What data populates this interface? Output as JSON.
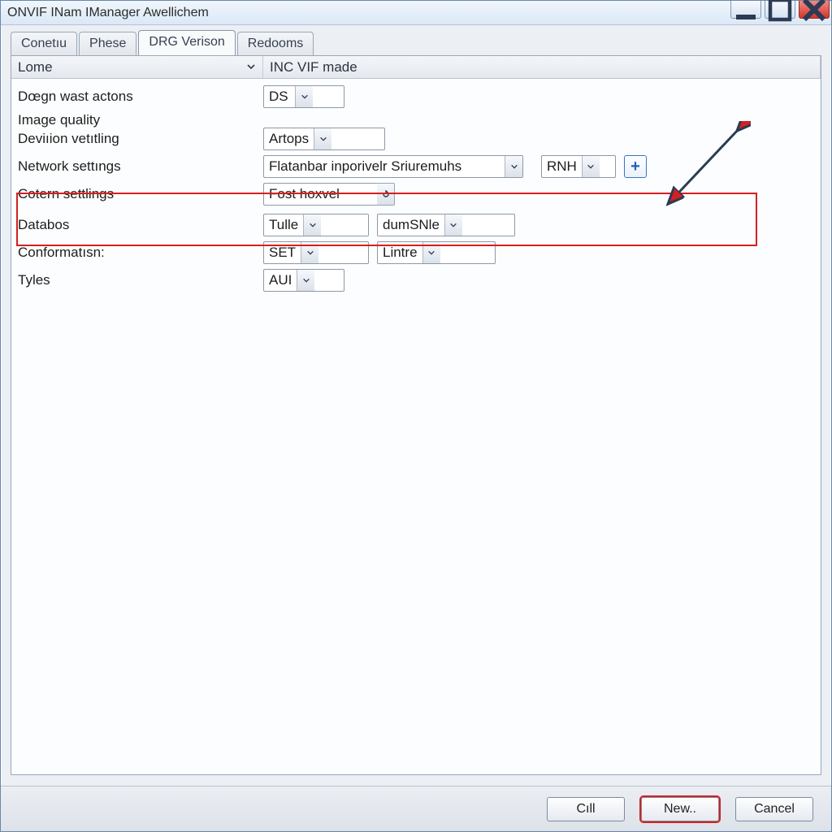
{
  "window": {
    "title": "ONVIF INam IManager Awellichem"
  },
  "tabs": {
    "items": [
      {
        "label": "Conetıu"
      },
      {
        "label": "Phese"
      },
      {
        "label": "DRG Verison"
      },
      {
        "label": "Redooms"
      }
    ],
    "active_index": 2
  },
  "grid_header": {
    "label_col": "Lome",
    "value_col": "INC VIF made"
  },
  "fields": {
    "design_actions": {
      "label": "Dœgn wast actons",
      "value": "DS"
    },
    "image_quality": {
      "label": "Image quality"
    },
    "deviation": {
      "label": "Deviıion vetıtling",
      "value": "Artops"
    },
    "network": {
      "label": "Network settıngs",
      "value": "Flatanbar inporivelr Sriuremuhs",
      "aux": "RNH"
    },
    "category": {
      "label": "Cotern settlings",
      "value": "Fost hoxvel"
    },
    "databos": {
      "label": "Databos",
      "value": "Tulle",
      "value2": "dumSNle"
    },
    "conformation": {
      "label": "Conformatısn:",
      "value": "SET",
      "value2": "Lintre"
    },
    "tyles": {
      "label": "Tyles",
      "value": "AUI"
    }
  },
  "footer": {
    "cil": "Cıll",
    "new": "New..",
    "cancel": "Cancel"
  },
  "icons": {
    "plus": "+"
  }
}
